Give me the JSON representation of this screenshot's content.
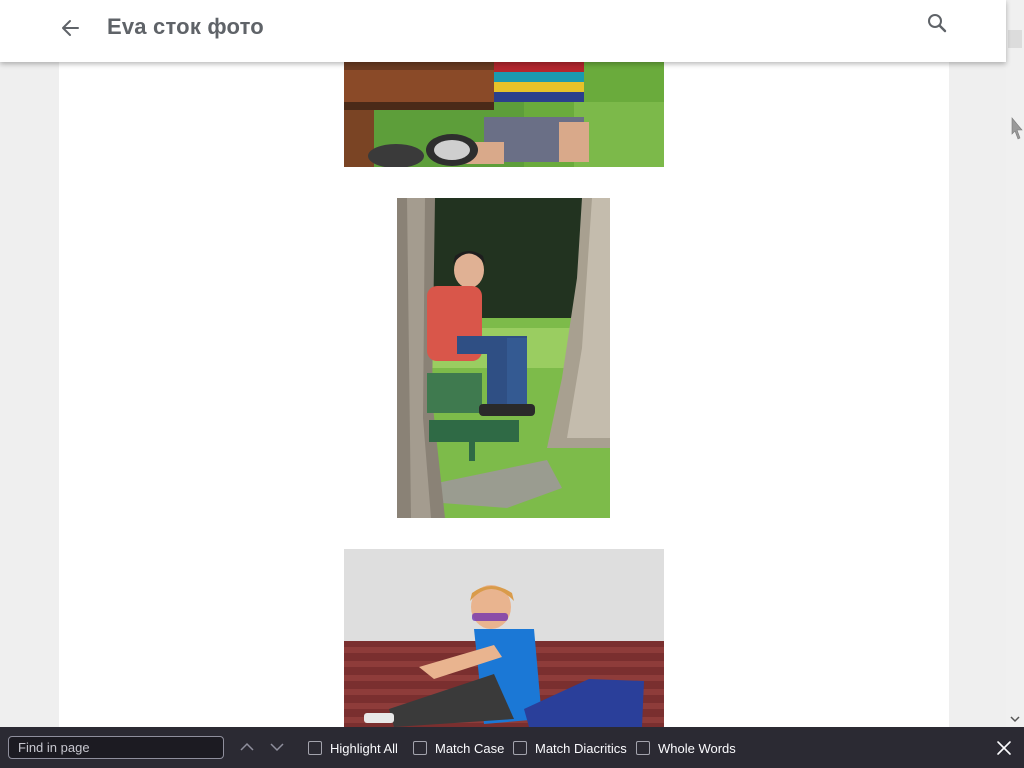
{
  "app_bar": {
    "title": "Eva сток фото",
    "back_icon": "arrow-back-icon",
    "search_icon": "search-icon"
  },
  "gallery": {
    "images": [
      {
        "subject": "boy-on-wooden-bench"
      },
      {
        "subject": "teen-on-bench-between-trees"
      },
      {
        "subject": "boy-with-glasses-on-red-bench"
      }
    ]
  },
  "find_bar": {
    "placeholder": "Find in page",
    "options": [
      {
        "label": "Highlight All",
        "checked": false
      },
      {
        "label": "Match Case",
        "checked": false
      },
      {
        "label": "Match Diacritics",
        "checked": false
      },
      {
        "label": "Whole Words",
        "checked": false
      }
    ],
    "prev_icon": "chevron-up-icon",
    "next_icon": "chevron-down-icon",
    "close_icon": "close-icon"
  },
  "colors": {
    "find_bar_bg": "#2b2a33",
    "title_text": "#5f6368"
  }
}
